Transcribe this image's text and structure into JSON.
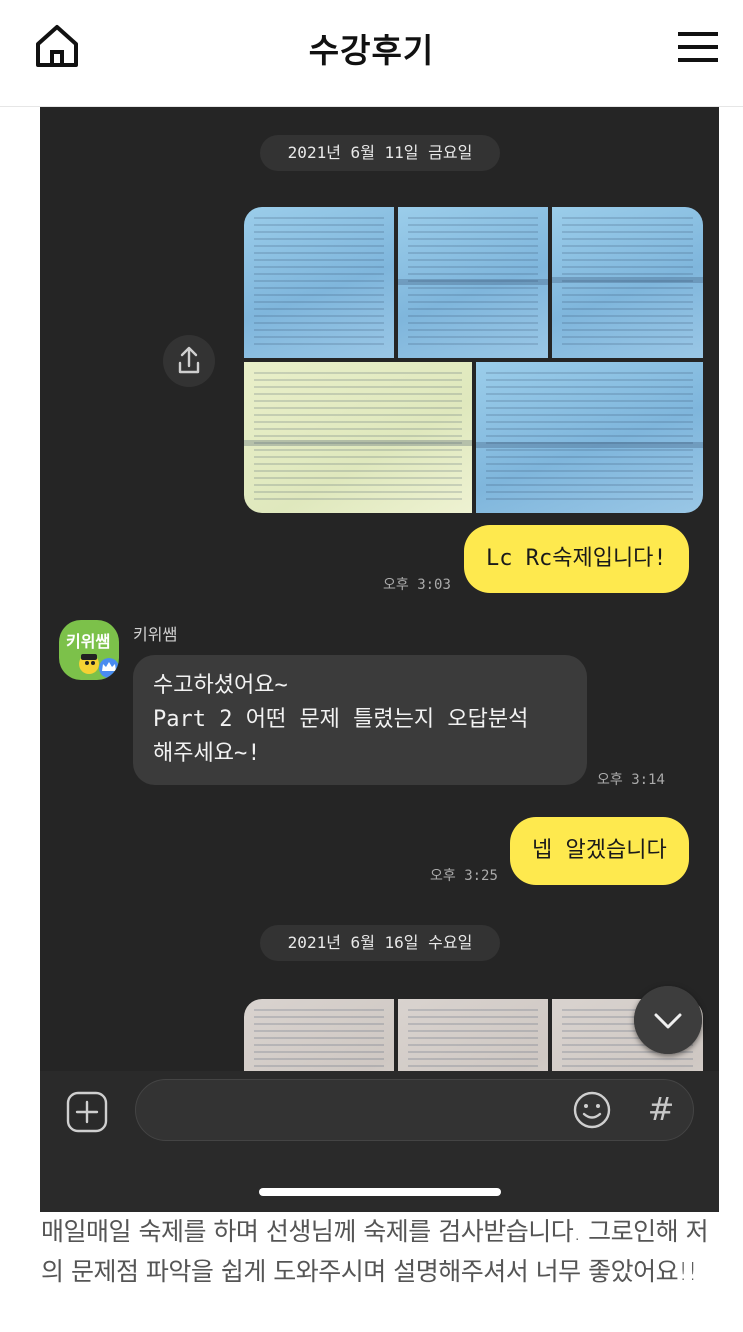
{
  "header": {
    "title": "수강후기",
    "home_icon": "home-icon",
    "menu_icon": "hamburger-menu-icon"
  },
  "chat": {
    "dates": [
      "2021년 6월 11일 금요일",
      "2021년 6월 16일 수요일"
    ],
    "messages": [
      {
        "from": "me",
        "text": "Lc Rc숙제입니다!",
        "time": "오후 3:03"
      },
      {
        "from": "other",
        "sender": "키위쌤",
        "lines": [
          "수고하셨어요~",
          "Part 2 어떤 문제 틀렸는지 오답분석",
          "해주세요~!"
        ],
        "time": "오후 3:14"
      },
      {
        "from": "me",
        "text": "넵 알겠습니다",
        "time": "오후 3:25"
      }
    ],
    "avatar_label": "키위쌤",
    "input": {
      "value": "",
      "placeholder": ""
    },
    "hash_label": "#",
    "colors": {
      "my_bubble": "#fee94e",
      "bg": "#252525",
      "their_bubble": "#3b3b3b"
    }
  },
  "review_text": "매일매일 숙제를 하며 선생님께 숙제를 검사받습니다. 그로인해 저의 문제점 파악을 쉽게 도와주시며 설명해주셔서 너무 좋았어요!!"
}
